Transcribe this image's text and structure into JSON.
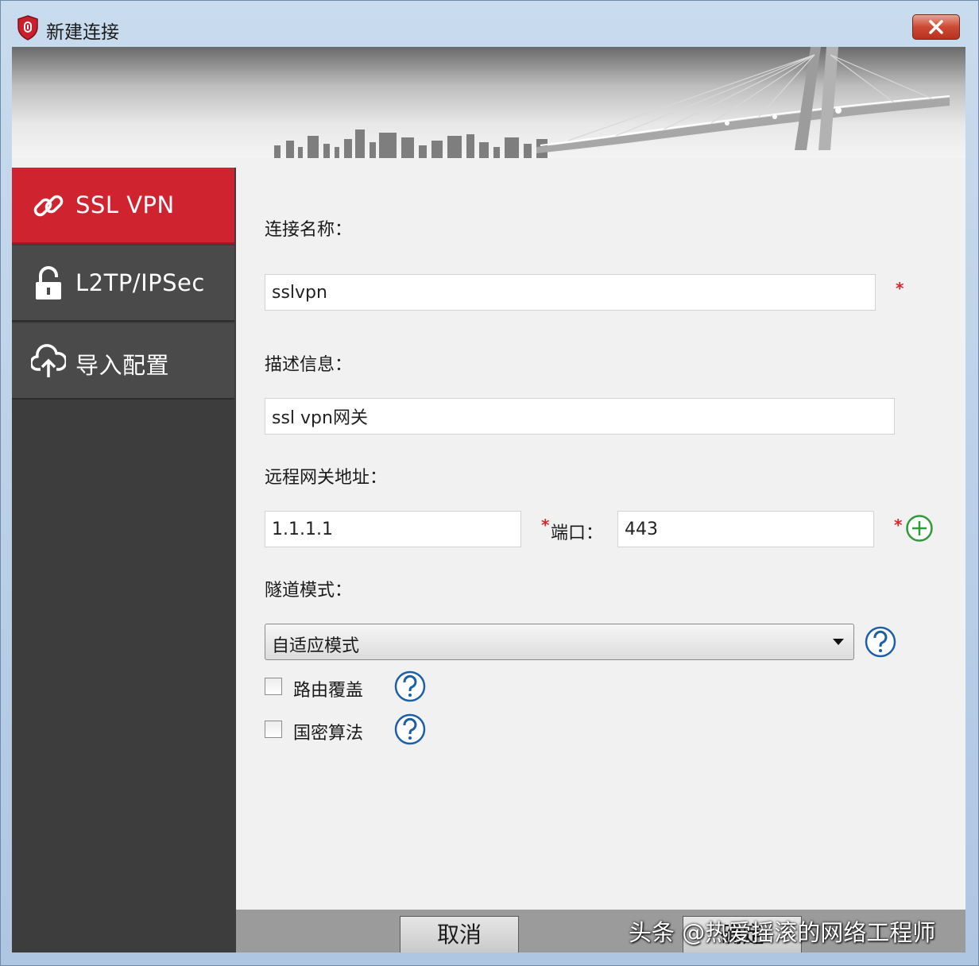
{
  "window": {
    "title": "新建连接",
    "close_icon": "close-icon"
  },
  "sidebar": {
    "items": [
      {
        "label": "SSL VPN",
        "icon": "link-icon",
        "active": true
      },
      {
        "label": "L2TP/IPSec",
        "icon": "unlock-icon",
        "active": false
      },
      {
        "label": "导入配置",
        "icon": "cloud-upload-icon",
        "active": false
      }
    ]
  },
  "form": {
    "connection_name_label": "连接名称：",
    "connection_name_value": "sslvpn",
    "description_label": "描述信息：",
    "description_value": "ssl vpn网关",
    "gateway_label": "远程网关地址：",
    "gateway_value": "1.1.1.1",
    "port_label": "端口：",
    "port_value": "443",
    "required_mark": "*",
    "tunnel_mode_label": "隧道模式：",
    "tunnel_mode_value": "自适应模式",
    "route_override_label": "路由覆盖",
    "route_override_checked": false,
    "sm_algorithm_label": "国密算法",
    "sm_algorithm_checked": false
  },
  "footer": {
    "cancel_label": "取消",
    "ok_label": "确定"
  },
  "watermark": "头条 @热爱摇滚的网络工程师",
  "colors": {
    "accent_red": "#cf2330",
    "sidebar_bg": "#4a4a4a",
    "add_green": "#2e9a3a",
    "help_blue": "#1d5fa6",
    "required_red": "#d42a2a"
  }
}
